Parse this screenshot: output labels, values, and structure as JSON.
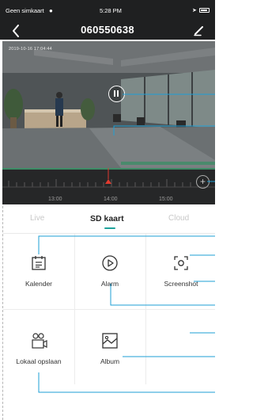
{
  "status_bar": {
    "carrier": "Geen simkaart",
    "time": "5:28 PM"
  },
  "nav": {
    "title": "060550638",
    "back_icon": "chevron-left-icon",
    "edit_icon": "pencil-icon"
  },
  "video": {
    "timestamp": "2019-10-16  17:04:44",
    "pause_icon": "pause-icon"
  },
  "timeline": {
    "labels": [
      "13:00",
      "14:00",
      "15:00"
    ],
    "zoom_label": "+",
    "marker_color": "#e03a2f"
  },
  "tabs": [
    {
      "label": "Live",
      "active": false
    },
    {
      "label": "SD kaart",
      "active": true
    },
    {
      "label": "Cloud",
      "active": false
    }
  ],
  "accent_color": "#1fa39b",
  "actions": [
    {
      "label": "Kalender",
      "icon": "calendar-icon"
    },
    {
      "label": "Alarm",
      "icon": "play-circle-icon"
    },
    {
      "label": "Screenshot",
      "icon": "screenshot-icon"
    },
    {
      "label": "Lokaal opslaan",
      "icon": "local-save-icon"
    },
    {
      "label": "Album",
      "icon": "album-icon"
    }
  ]
}
